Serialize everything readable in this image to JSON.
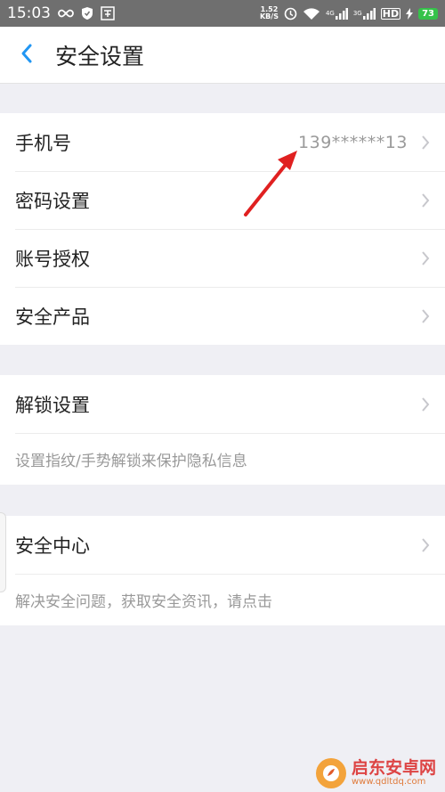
{
  "status_bar": {
    "time": "15:03",
    "net_speed": "1.52\nKB/S",
    "signal_1": "4G",
    "signal_2": "3G",
    "hd": "HD",
    "battery": "73"
  },
  "header": {
    "title": "安全设置"
  },
  "group1": {
    "items": [
      {
        "label": "手机号",
        "value": "139******13"
      },
      {
        "label": "密码设置"
      },
      {
        "label": "账号授权"
      },
      {
        "label": "安全产品"
      }
    ]
  },
  "group2": {
    "label": "解锁设置",
    "hint": "设置指纹/手势解锁来保护隐私信息"
  },
  "group3": {
    "label": "安全中心",
    "hint": "解决安全问题，获取安全资讯，请点击"
  },
  "watermark": {
    "name": "启东安卓网",
    "url": "www.qdltdq.com"
  },
  "colors": {
    "accent": "#2196f3",
    "arrow": "#e02020",
    "status_bar": "#6f6f6f",
    "background": "#efeff4"
  }
}
